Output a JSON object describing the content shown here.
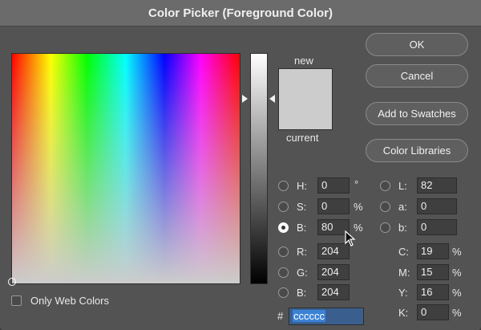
{
  "dialog": {
    "title": "Color Picker (Foreground Color)"
  },
  "swatches": {
    "new_label": "new",
    "current_label": "current",
    "color": "#cccccc"
  },
  "buttons": {
    "ok": "OK",
    "cancel": "Cancel",
    "add_to_swatches": "Add to Swatches",
    "color_libraries": "Color Libraries"
  },
  "hsb": {
    "h": {
      "label": "H:",
      "value": "0",
      "unit": "°",
      "selected": false
    },
    "s": {
      "label": "S:",
      "value": "0",
      "unit": "%",
      "selected": false
    },
    "b": {
      "label": "B:",
      "value": "80",
      "unit": "%",
      "selected": true
    }
  },
  "rgb": {
    "r": {
      "label": "R:",
      "value": "204"
    },
    "g": {
      "label": "G:",
      "value": "204"
    },
    "b": {
      "label": "B:",
      "value": "204"
    }
  },
  "lab": {
    "l": {
      "label": "L:",
      "value": "82"
    },
    "a": {
      "label": "a:",
      "value": "0"
    },
    "b": {
      "label": "b:",
      "value": "0"
    }
  },
  "cmyk": {
    "c": {
      "label": "C:",
      "value": "19",
      "unit": "%"
    },
    "m": {
      "label": "M:",
      "value": "15",
      "unit": "%"
    },
    "y": {
      "label": "Y:",
      "value": "16",
      "unit": "%"
    },
    "k": {
      "label": "K:",
      "value": "0",
      "unit": "%"
    }
  },
  "hex": {
    "prefix": "#",
    "value": "cccccc"
  },
  "only_web_colors": {
    "label": "Only Web Colors",
    "checked": false
  }
}
